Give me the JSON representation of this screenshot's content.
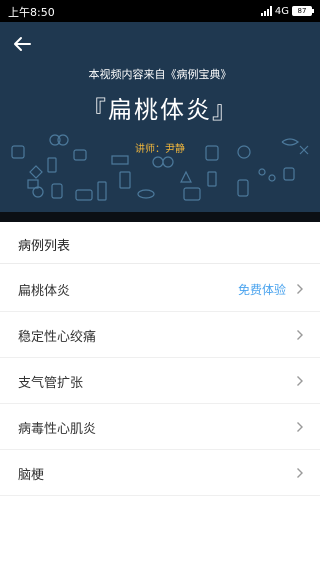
{
  "status_bar": {
    "time": "上午8:50",
    "network": "4G",
    "battery": "87"
  },
  "banner": {
    "source_text": "本视频内容来自《病例宝典》",
    "title": "『扁桃体炎』",
    "lecturer": "讲师：尹静",
    "background_color": "#1f3850",
    "accent_color": "#f0b63c"
  },
  "list": {
    "header": "病例列表",
    "items": [
      {
        "label": "扁桃体炎",
        "tag": "免费体验"
      },
      {
        "label": "稳定性心绞痛",
        "tag": ""
      },
      {
        "label": "支气管扩张",
        "tag": ""
      },
      {
        "label": "病毒性心肌炎",
        "tag": ""
      },
      {
        "label": "脑梗",
        "tag": ""
      }
    ],
    "tag_color": "#4aa3ee"
  },
  "icons": {
    "back": "back-arrow-icon",
    "row_chevron": "chevron-right-icon"
  }
}
